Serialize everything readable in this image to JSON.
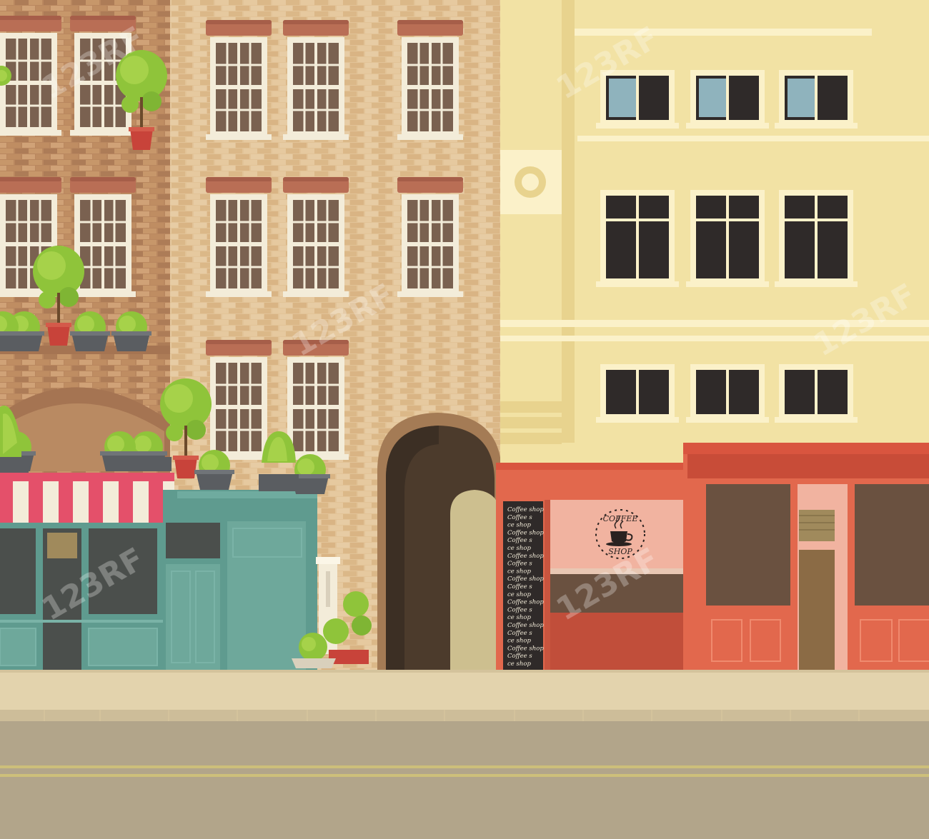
{
  "scene": {
    "sign_label": "Coffee shop",
    "sign_lines": [
      "Coffee shop",
      "Coffee s",
      "ce shop",
      "Coffee shop",
      "Coffee s",
      "ce shop",
      "Coffee shop",
      "Coffee s",
      "ce shop",
      "Coffee shop",
      "Coffee s",
      "ce shop",
      "Coffee shop",
      "Coffee s",
      "ce shop",
      "Coffee shop",
      "Coffee s",
      "ce shop",
      "Coffee shop",
      "Coffee s",
      "ce shop"
    ],
    "logo": {
      "top": "COFFEE",
      "bottom": "SHOP"
    },
    "watermark": "123RF"
  },
  "colors": {
    "brick": "#e2c397",
    "brick_dark": "#c79a66",
    "yellow_building": "#f2e2a4",
    "cafe_red": "#e2684d",
    "teal_shop": "#5f9b8f",
    "awning_red": "#e4506a",
    "sidewalk": "#e3d3ad",
    "road": "#b2a58a"
  }
}
